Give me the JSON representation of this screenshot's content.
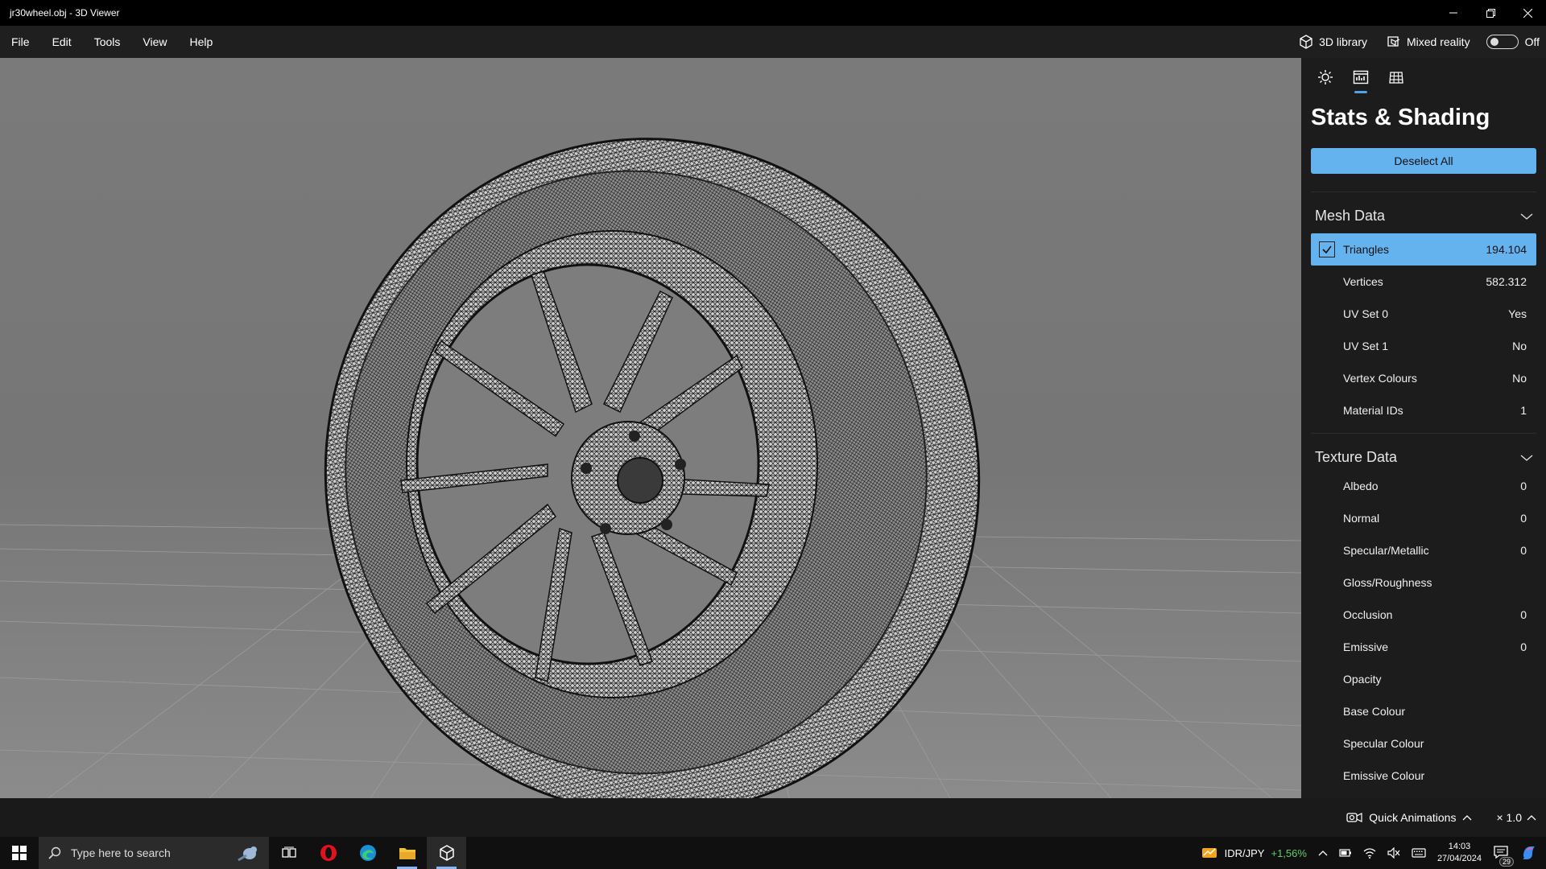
{
  "window": {
    "title": "jr30wheel.obj - 3D Viewer",
    "controls": [
      "minimize",
      "restore",
      "close"
    ]
  },
  "menubar": {
    "items": [
      "File",
      "Edit",
      "Tools",
      "View",
      "Help"
    ],
    "library_label": "3D library",
    "mixed_reality_label": "Mixed reality",
    "toggle_state": "Off"
  },
  "panel": {
    "tabs": [
      "lighting-icon",
      "stats-icon",
      "grid-icon"
    ],
    "active_tab": 1,
    "title": "Stats & Shading",
    "deselect_label": "Deselect All",
    "mesh_section": "Mesh Data",
    "mesh_rows": [
      {
        "label": "Triangles",
        "value": "194.104",
        "checked": true
      },
      {
        "label": "Vertices",
        "value": "582.312"
      },
      {
        "label": "UV Set 0",
        "value": "Yes"
      },
      {
        "label": "UV Set 1",
        "value": "No"
      },
      {
        "label": "Vertex Colours",
        "value": "No"
      },
      {
        "label": "Material IDs",
        "value": "1"
      }
    ],
    "texture_section": "Texture Data",
    "texture_rows": [
      {
        "label": "Albedo",
        "value": "0"
      },
      {
        "label": "Normal",
        "value": "0"
      },
      {
        "label": "Specular/Metallic",
        "value": "0"
      },
      {
        "label": "Gloss/Roughness",
        "value": ""
      },
      {
        "label": "Occlusion",
        "value": "0"
      },
      {
        "label": "Emissive",
        "value": "0"
      },
      {
        "label": "Opacity",
        "value": ""
      },
      {
        "label": "Base Colour",
        "value": ""
      },
      {
        "label": "Specular Colour",
        "value": ""
      },
      {
        "label": "Emissive Colour",
        "value": ""
      }
    ]
  },
  "bottombar": {
    "quick_animations": "Quick Animations",
    "speed": "× 1.0"
  },
  "taskbar": {
    "search_placeholder": "Type here to search",
    "ticker_symbol": "IDR/JPY",
    "ticker_change": "+1,56%",
    "time": "14:03",
    "date": "27/04/2024",
    "notification_count": "29"
  },
  "colors": {
    "accent": "#65b3ee",
    "panel_bg": "#1c1c1c",
    "viewport_bg": "#7a7a7a",
    "ticker_up": "#5fcf6b"
  }
}
